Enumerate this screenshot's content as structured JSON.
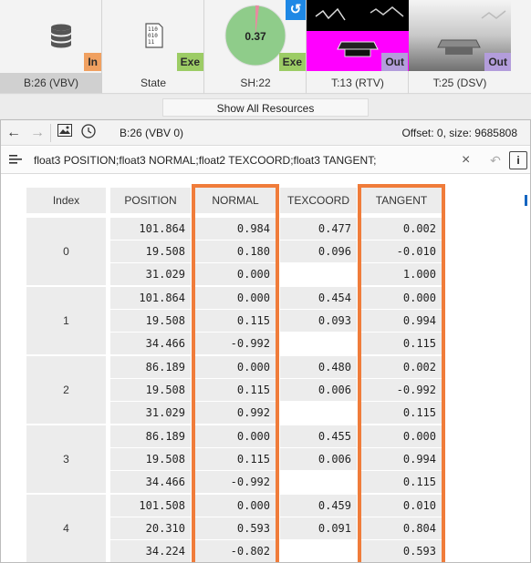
{
  "resources": [
    {
      "label": "B:26 (VBV)",
      "tag": "In",
      "icon": "database-icon",
      "selected": true
    },
    {
      "label": "State",
      "tag": "Exe",
      "icon": "state-binary-icon",
      "selected": false,
      "icon_text": "110\n010\n11"
    },
    {
      "label": "SH:22",
      "tag": "Exe",
      "icon": "pie-chart-icon",
      "selected": false,
      "pie_value": "0.37",
      "pie_fraction": 0.37
    },
    {
      "label": "T:13 (RTV)",
      "tag": "Out",
      "icon": "render-target-thumbnail",
      "selected": false
    },
    {
      "label": "T:25 (DSV)",
      "tag": "Out",
      "icon": "depth-stencil-thumbnail",
      "selected": false
    }
  ],
  "show_all_label": "Show All Resources",
  "toolbar": {
    "buffer_name": "B:26 (VBV 0)",
    "offset_text": "Offset: 0, size: 9685808"
  },
  "format": {
    "text": "float3 POSITION;float3 NORMAL;float2 TEXCOORD;float3 TANGENT;"
  },
  "table": {
    "columns": [
      "Index",
      "POSITION",
      "NORMAL",
      "TEXCOORD",
      "TANGENT"
    ],
    "highlighted_columns": [
      "NORMAL",
      "TANGENT"
    ],
    "rows": [
      {
        "index": "0",
        "position": [
          "101.864",
          "19.508",
          "31.029"
        ],
        "normal": [
          "0.984",
          "0.180",
          "0.000"
        ],
        "texcoord": [
          "0.477",
          "0.096"
        ],
        "tangent": [
          "0.002",
          "-0.010",
          "1.000"
        ]
      },
      {
        "index": "1",
        "position": [
          "101.864",
          "19.508",
          "34.466"
        ],
        "normal": [
          "0.000",
          "0.115",
          "-0.992"
        ],
        "texcoord": [
          "0.454",
          "0.093"
        ],
        "tangent": [
          "0.000",
          "0.994",
          "0.115"
        ]
      },
      {
        "index": "2",
        "position": [
          "86.189",
          "19.508",
          "31.029"
        ],
        "normal": [
          "0.000",
          "0.115",
          "0.992"
        ],
        "texcoord": [
          "0.480",
          "0.006"
        ],
        "tangent": [
          "0.002",
          "-0.992",
          "0.115"
        ]
      },
      {
        "index": "3",
        "position": [
          "86.189",
          "19.508",
          "34.466"
        ],
        "normal": [
          "0.000",
          "0.115",
          "-0.992"
        ],
        "texcoord": [
          "0.455",
          "0.006"
        ],
        "tangent": [
          "0.000",
          "0.994",
          "0.115"
        ]
      },
      {
        "index": "4",
        "position": [
          "101.508",
          "20.310",
          "34.224"
        ],
        "normal": [
          "0.000",
          "0.593",
          "-0.802"
        ],
        "texcoord": [
          "0.459",
          "0.091"
        ],
        "tangent": [
          "0.010",
          "0.804",
          "0.593"
        ]
      }
    ]
  },
  "colors": {
    "highlight": "#f07c3a",
    "in_tag": "#f0a060",
    "exe_tag": "#9ccc65",
    "out_tag": "#b39ddb",
    "reset_button": "#1e88e5",
    "pie_fill": "#8fcc8a",
    "rtv_magenta": "#ff00ff"
  }
}
